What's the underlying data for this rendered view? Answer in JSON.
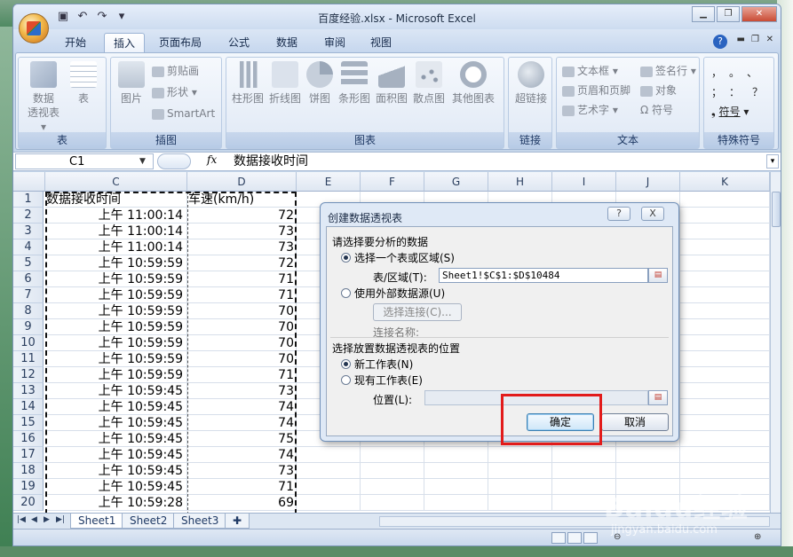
{
  "window": {
    "title": "百度经验.xlsx - Microsoft Excel"
  },
  "ribbon_tabs": [
    "开始",
    "插入",
    "页面布局",
    "公式",
    "数据",
    "审阅",
    "视图"
  ],
  "ribbon": {
    "tables": {
      "label": "表",
      "pivot": "数据\n透视表",
      "table": "表"
    },
    "illustrations": {
      "label": "插图",
      "picture": "图片",
      "clipart": "剪贴画",
      "shapes": "形状",
      "smartart": "SmartArt"
    },
    "charts": {
      "label": "图表",
      "column": "柱形图",
      "line": "折线图",
      "pie": "饼图",
      "bar": "条形图",
      "area": "面积图",
      "scatter": "散点图",
      "other": "其他图表"
    },
    "links": {
      "label": "链接",
      "hyperlink": "超链接"
    },
    "text": {
      "label": "文本",
      "textbox": "文本框",
      "header_footer": "页眉和页脚",
      "wordart": "艺术字",
      "signature": "签名行",
      "object": "对象",
      "symbol": "符号"
    },
    "special": {
      "label": "特殊符号",
      "symbol": "符号",
      "chars": "，。、；：？"
    }
  },
  "formula_bar": {
    "name_box": "C1",
    "fx": "fx",
    "formula": "数据接收时间"
  },
  "grid": {
    "columns": [
      "C",
      "D",
      "E",
      "F",
      "G",
      "H",
      "I",
      "J",
      "K"
    ],
    "header_row": {
      "c": "数据接收时间",
      "d": "车速(km/h)"
    },
    "rows": [
      {
        "n": "2",
        "t": "上午 11:00:14",
        "v": "72"
      },
      {
        "n": "3",
        "t": "上午 11:00:14",
        "v": "73"
      },
      {
        "n": "4",
        "t": "上午 11:00:14",
        "v": "73"
      },
      {
        "n": "5",
        "t": "上午 10:59:59",
        "v": "72"
      },
      {
        "n": "6",
        "t": "上午 10:59:59",
        "v": "71"
      },
      {
        "n": "7",
        "t": "上午 10:59:59",
        "v": "71"
      },
      {
        "n": "8",
        "t": "上午 10:59:59",
        "v": "70"
      },
      {
        "n": "9",
        "t": "上午 10:59:59",
        "v": "70"
      },
      {
        "n": "10",
        "t": "上午 10:59:59",
        "v": "70"
      },
      {
        "n": "11",
        "t": "上午 10:59:59",
        "v": "70"
      },
      {
        "n": "12",
        "t": "上午 10:59:59",
        "v": "71"
      },
      {
        "n": "13",
        "t": "上午 10:59:45",
        "v": "73"
      },
      {
        "n": "14",
        "t": "上午 10:59:45",
        "v": "74"
      },
      {
        "n": "15",
        "t": "上午 10:59:45",
        "v": "74"
      },
      {
        "n": "16",
        "t": "上午 10:59:45",
        "v": "75"
      },
      {
        "n": "17",
        "t": "上午 10:59:45",
        "v": "74"
      },
      {
        "n": "18",
        "t": "上午 10:59:45",
        "v": "73"
      },
      {
        "n": "19",
        "t": "上午 10:59:45",
        "v": "71"
      },
      {
        "n": "20",
        "t": "上午 10:59:28",
        "v": "69"
      }
    ]
  },
  "sheets": [
    "Sheet1",
    "Sheet2",
    "Sheet3"
  ],
  "dialog": {
    "title": "创建数据透视表",
    "help": "?",
    "close": "X",
    "section1": "请选择要分析的数据",
    "opt_range": "选择一个表或区域(S)",
    "range_label": "表/区域(T):",
    "range_value": "Sheet1!$C$1:$D$10484",
    "opt_external": "使用外部数据源(U)",
    "choose_conn": "选择连接(C)...",
    "conn_name": "连接名称:",
    "section2": "选择放置数据透视表的位置",
    "opt_new": "新工作表(N)",
    "opt_existing": "现有工作表(E)",
    "location_label": "位置(L):",
    "ok": "确定",
    "cancel": "取消"
  },
  "watermark": {
    "brand": "Baidu经验",
    "url": "jingyan.baidu.com"
  }
}
